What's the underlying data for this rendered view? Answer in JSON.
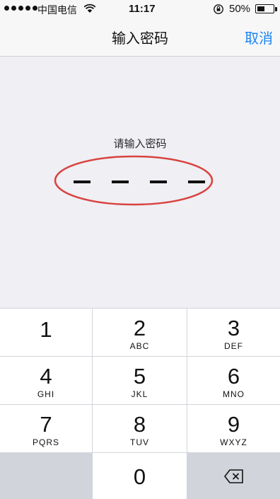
{
  "status_bar": {
    "carrier": "中国电信",
    "time": "11:17",
    "battery_percent": "50%",
    "battery_level": 0.5,
    "signal_dots": 5,
    "icons": [
      "wifi-icon",
      "rotation-lock-icon",
      "battery-icon"
    ]
  },
  "nav_bar": {
    "title": "输入密码",
    "cancel_label": "取消",
    "accent_color": "#1b84f2"
  },
  "passcode": {
    "prompt": "请输入密码",
    "digit_slots": 4,
    "highlight_color": "#d9433f"
  },
  "keypad": {
    "keys": [
      {
        "digit": "1",
        "letters": ""
      },
      {
        "digit": "2",
        "letters": "ABC"
      },
      {
        "digit": "3",
        "letters": "DEF"
      },
      {
        "digit": "4",
        "letters": "GHI"
      },
      {
        "digit": "5",
        "letters": "JKL"
      },
      {
        "digit": "6",
        "letters": "MNO"
      },
      {
        "digit": "7",
        "letters": "PQRS"
      },
      {
        "digit": "8",
        "letters": "TUV"
      },
      {
        "digit": "9",
        "letters": "WXYZ"
      },
      {
        "digit": "",
        "letters": ""
      },
      {
        "digit": "0",
        "letters": ""
      },
      {
        "digit": "",
        "letters": "",
        "icon": "delete-backspace-icon"
      }
    ]
  }
}
